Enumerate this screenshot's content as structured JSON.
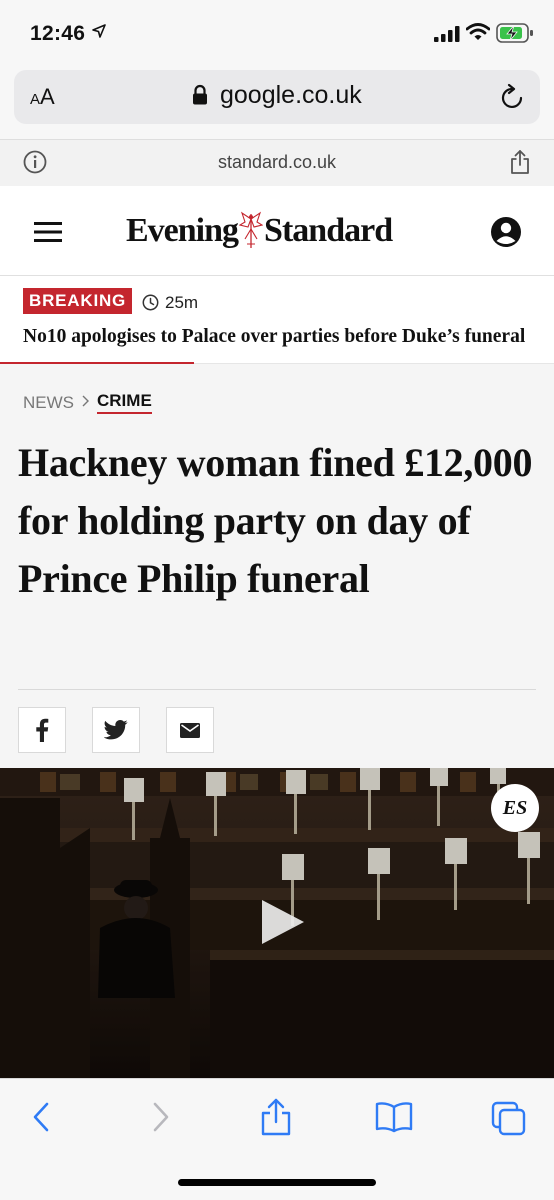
{
  "status_bar": {
    "time": "12:46",
    "icons": [
      "location-arrow-icon",
      "cellular-signal-icon",
      "wifi-icon",
      "battery-charging-icon"
    ]
  },
  "browser": {
    "text_size_label_small": "A",
    "text_size_label_large": "A",
    "url": "google.co.uk",
    "site_domain": "standard.co.uk"
  },
  "site": {
    "logo_left": "Evening",
    "logo_right": "Standard"
  },
  "breaking": {
    "badge": "BREAKING",
    "time": "25m",
    "headline": "No10 apologises to Palace over parties before Duke’s funeral",
    "progress": 0.35
  },
  "article": {
    "breadcrumb": {
      "section": "NEWS",
      "subsection": "CRIME"
    },
    "headline": "Hackney woman fined £12,000 for holding party on day of Prince Philip funeral",
    "share_buttons": [
      "facebook-icon",
      "twitter-icon",
      "email-icon"
    ]
  },
  "video": {
    "badge": "ES"
  },
  "colors": {
    "accent": "#c4262e",
    "ios_blue": "#2f7bf5"
  }
}
